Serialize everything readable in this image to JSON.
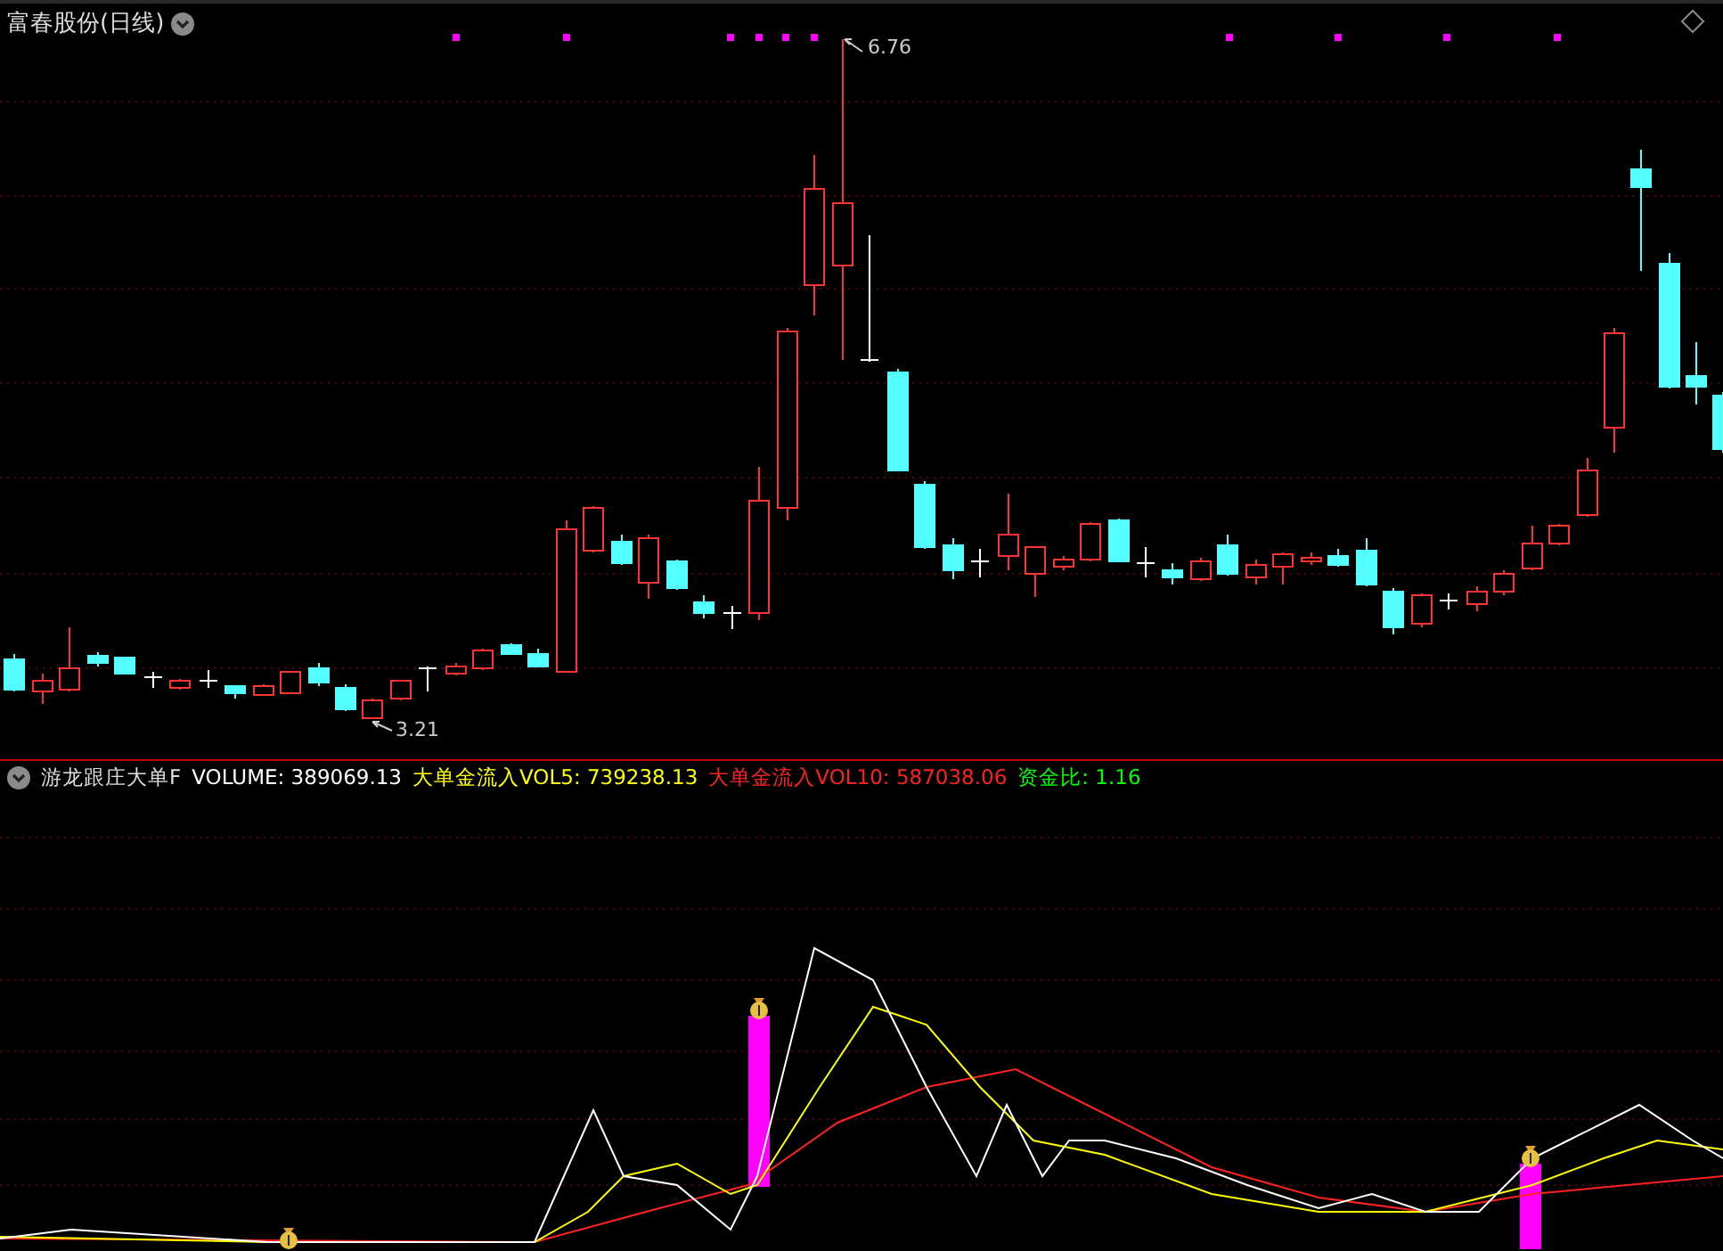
{
  "header": {
    "stock_name": "富春股份",
    "period": "(日线)"
  },
  "price_chart": {
    "high_label": "6.76",
    "low_label": "3.21"
  },
  "indicator": {
    "name": "游龙跟庄大单F",
    "values": [
      {
        "text": "VOLUME: 389069.13",
        "color": "#ffffff"
      },
      {
        "text": "大单金流入VOL5: 739238.13",
        "color": "#ffff00"
      },
      {
        "text": "大单金流入VOL10: 587038.06",
        "color": "#ff2020"
      },
      {
        "text": "资金比: 1.16",
        "color": "#00ff00"
      }
    ]
  }
}
